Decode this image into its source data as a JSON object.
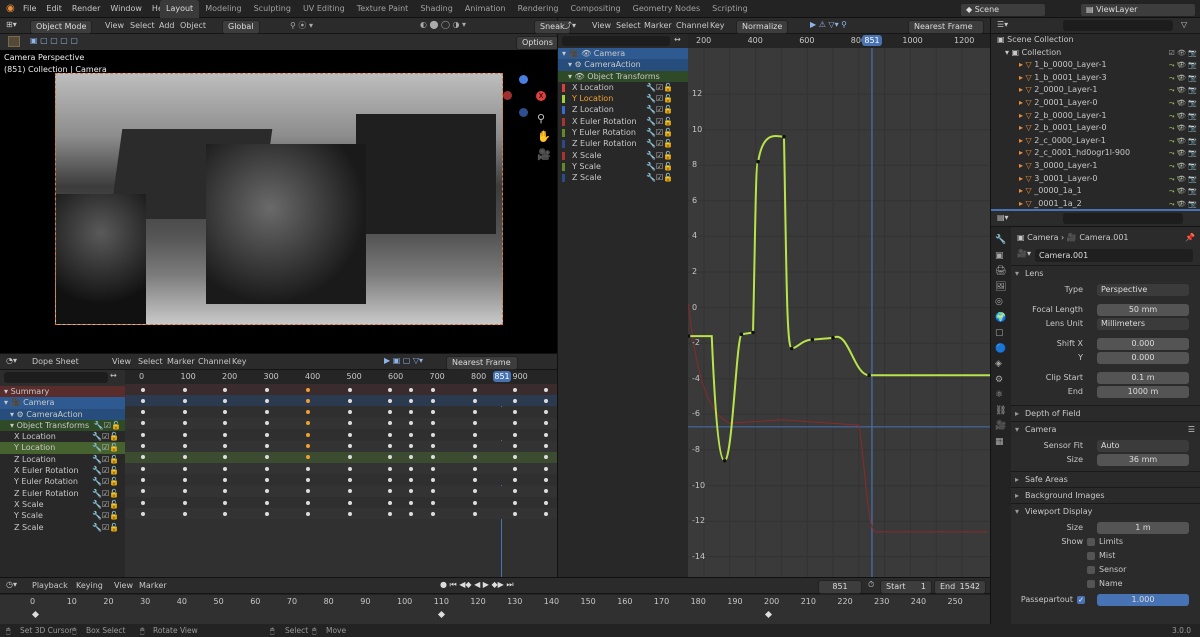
{
  "menu": [
    "File",
    "Edit",
    "Render",
    "Window",
    "Help"
  ],
  "workspaces": [
    "Layout",
    "Modeling",
    "Sculpting",
    "UV Editing",
    "Texture Paint",
    "Shading",
    "Animation",
    "Rendering",
    "Compositing",
    "Geometry Nodes",
    "Scripting"
  ],
  "scene": "Scene",
  "view_layer": "ViewLayer",
  "viewport": {
    "mode": "Object Mode",
    "menus": [
      "View",
      "Select",
      "Add",
      "Object"
    ],
    "orient": "Global",
    "options": "Options",
    "title": "Camera Perspective",
    "subtitle": "(851) Collection | Camera",
    "axes": [
      "X",
      "Y",
      "Z"
    ]
  },
  "graph": {
    "menus": [
      "View",
      "Select",
      "Marker",
      "Channel",
      "Key"
    ],
    "normalize": "Normalize",
    "snap": "Nearest Frame",
    "sneak": "Sneak",
    "frame": "851",
    "ticks_x": [
      "200",
      "400",
      "600",
      "800",
      "1000",
      "1200"
    ],
    "ticks_y": [
      "12",
      "10",
      "8",
      "6",
      "4",
      "2",
      "0",
      "-2",
      "-4",
      "-6",
      "-8",
      "-10",
      "-12",
      "-14"
    ]
  },
  "channels": {
    "camera": "Camera",
    "action": "CameraAction",
    "group": "Object Transforms",
    "items": [
      "X Location",
      "Y Location",
      "Z Location",
      "X Euler Rotation",
      "Y Euler Rotation",
      "Z Euler Rotation",
      "X Scale",
      "Y Scale",
      "Z Scale"
    ],
    "colors": [
      "#d94040",
      "#9ed23a",
      "#3a6bd4",
      "#a83333",
      "#5e8a2a",
      "#2a4a8a",
      "#a83333",
      "#5e8a2a",
      "#2a4a8a"
    ]
  },
  "dope": {
    "editor": "Dope Sheet",
    "menus": [
      "View",
      "Select",
      "Marker",
      "Channel",
      "Key"
    ],
    "snap": "Nearest Frame",
    "frame": "851",
    "summary": "Summary",
    "ticks": [
      "0",
      "100",
      "200",
      "300",
      "400",
      "500",
      "600",
      "700",
      "800",
      "900"
    ]
  },
  "timeline": {
    "menus": [
      "Playback",
      "Keying",
      "View",
      "Marker"
    ],
    "frame": "851",
    "start_label": "Start",
    "start": "1",
    "end_label": "End",
    "end": "1542",
    "ticks": [
      "0",
      "10",
      "20",
      "30",
      "40",
      "50",
      "60",
      "70",
      "80",
      "90",
      "100",
      "110",
      "120",
      "130",
      "140",
      "150",
      "160",
      "170",
      "180",
      "190",
      "200",
      "210",
      "220",
      "230",
      "240",
      "250"
    ]
  },
  "status": {
    "left": "Set 3D Cursor",
    "box": "Box Select",
    "rotate": "Rotate View",
    "select": "Select",
    "move": "Move",
    "version": "3.0.0"
  },
  "outliner": {
    "root": "Scene Collection",
    "collection": "Collection",
    "items": [
      "1_b_0000_Layer-1",
      "1_b_0001_Layer-3",
      "2_0000_Layer-1",
      "2_0001_Layer-0",
      "2_b_0000_Layer-1",
      "2_b_0001_Layer-0",
      "2_c_0000_Layer-1",
      "2_c_0001_hd0ogr1l-900",
      "3_0000_Layer-1",
      "3_0001_Layer-0",
      "_0000_1a_1",
      "_0001_1a_2"
    ]
  },
  "props": {
    "breadcrumb_a": "Camera",
    "breadcrumb_b": "Camera.001",
    "data_name": "Camera.001",
    "lens": "Lens",
    "type_label": "Type",
    "type": "Perspective",
    "focal_label": "Focal Length",
    "focal": "50 mm",
    "unit_label": "Lens Unit",
    "unit": "Millimeters",
    "shiftx_label": "Shift X",
    "shiftx": "0.000",
    "y_label": "Y",
    "shifty": "0.000",
    "clipstart_label": "Clip Start",
    "clipstart": "0.1 m",
    "end_label": "End",
    "clipend": "1000 m",
    "dof": "Depth of Field",
    "camera": "Camera",
    "sensor_label": "Sensor Fit",
    "sensor": "Auto",
    "size_label": "Size",
    "size": "36 mm",
    "safe": "Safe Areas",
    "bg": "Background Images",
    "vpd": "Viewport Display",
    "vsize_label": "Size",
    "vsize": "1 m",
    "show_label": "Show",
    "limits": "Limits",
    "mist": "Mist",
    "sensor_cb": "Sensor",
    "name_cb": "Name",
    "passe_label": "Passepartout",
    "passe": "1.000"
  }
}
